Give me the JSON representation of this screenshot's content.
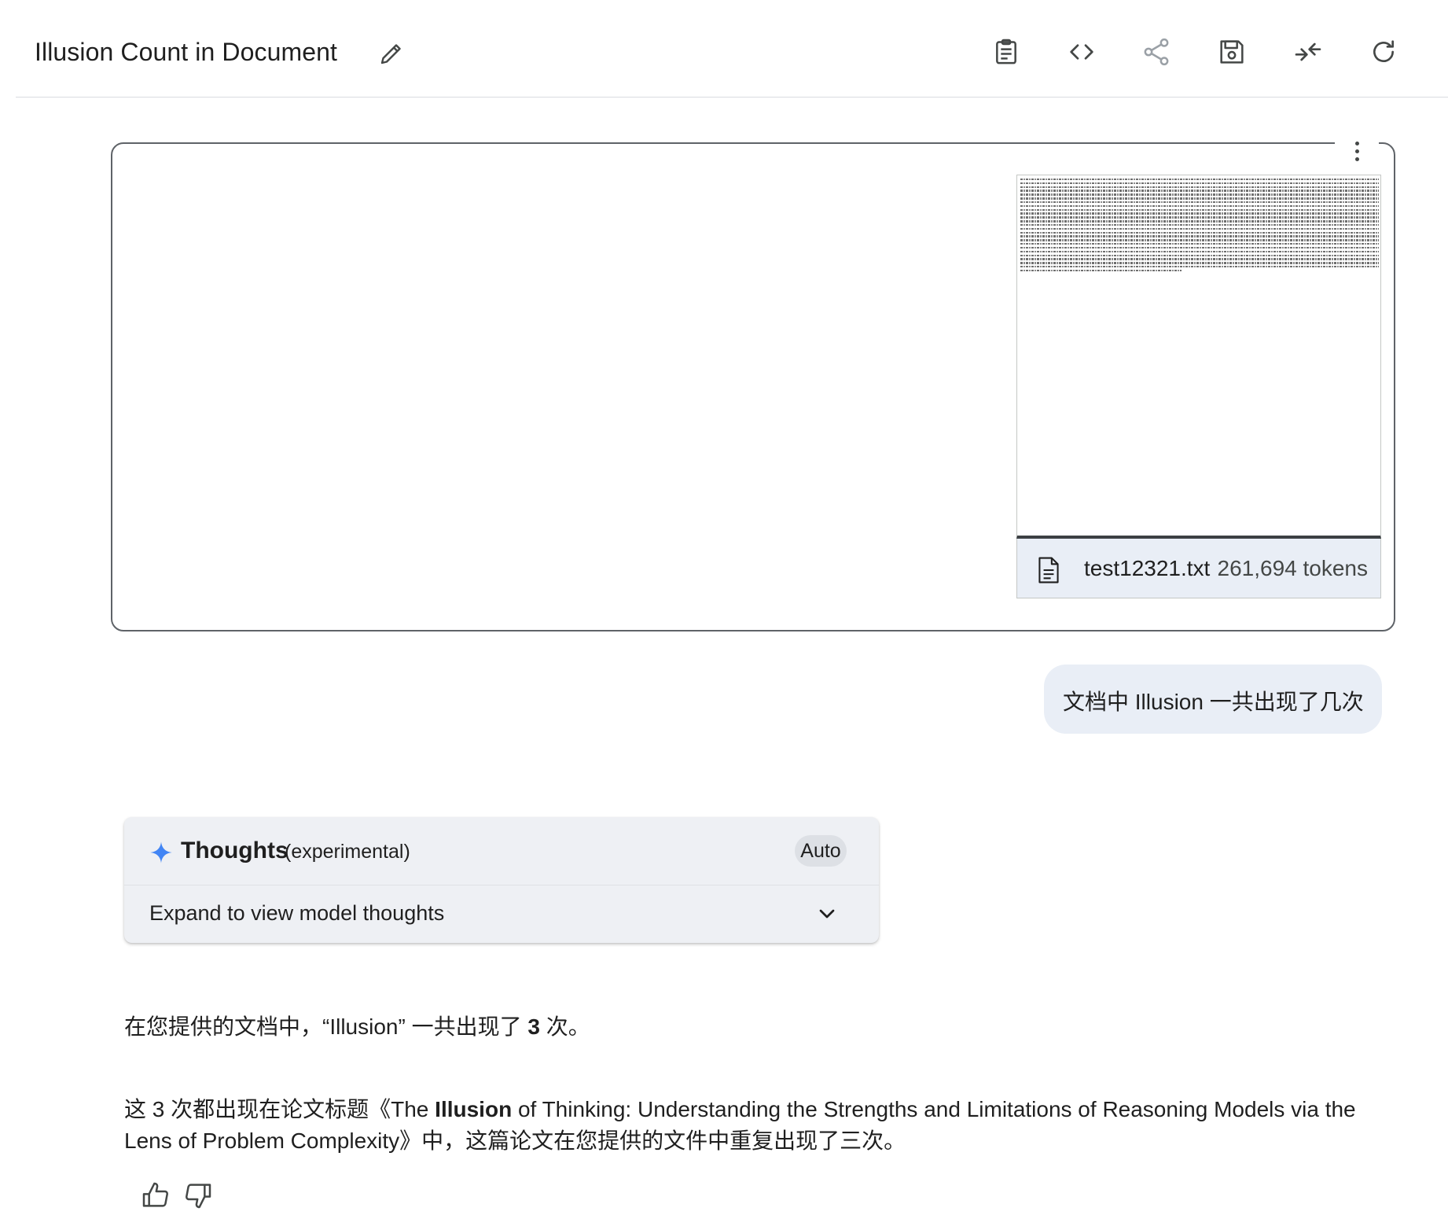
{
  "header": {
    "title": "Illusion Count in Document",
    "icons": [
      "edit-icon",
      "clipboard-icon",
      "code-icon",
      "share-icon",
      "save-icon",
      "collapse-icon",
      "refresh-icon"
    ]
  },
  "attachment": {
    "file_name": "test12321.txt",
    "tokens": "261,694 tokens"
  },
  "user_message": {
    "text": "文档中 Illusion 一共出现了几次"
  },
  "thoughts": {
    "title": "Thoughts",
    "subtitle": "(experimental)",
    "badge": "Auto",
    "expand_label": "Expand to view model thoughts"
  },
  "response": {
    "p1_before": "在您提供的文档中，“Illusion” 一共出现了 ",
    "p1_count": "3",
    "p1_after": " 次。",
    "p2_before": "这 3 次都出现在论文标题《The ",
    "p2_bold": "Illusion",
    "p2_after": " of Thinking: Understanding the Strengths and Limitations of Reasoning Models via the Lens of Problem Complexity》中，这篇论文在您提供的文件中重复出现了三次。"
  },
  "colors": {
    "bubble": "#e9eef6",
    "sparkle": "#4285f4",
    "panel": "#eef0f4"
  }
}
